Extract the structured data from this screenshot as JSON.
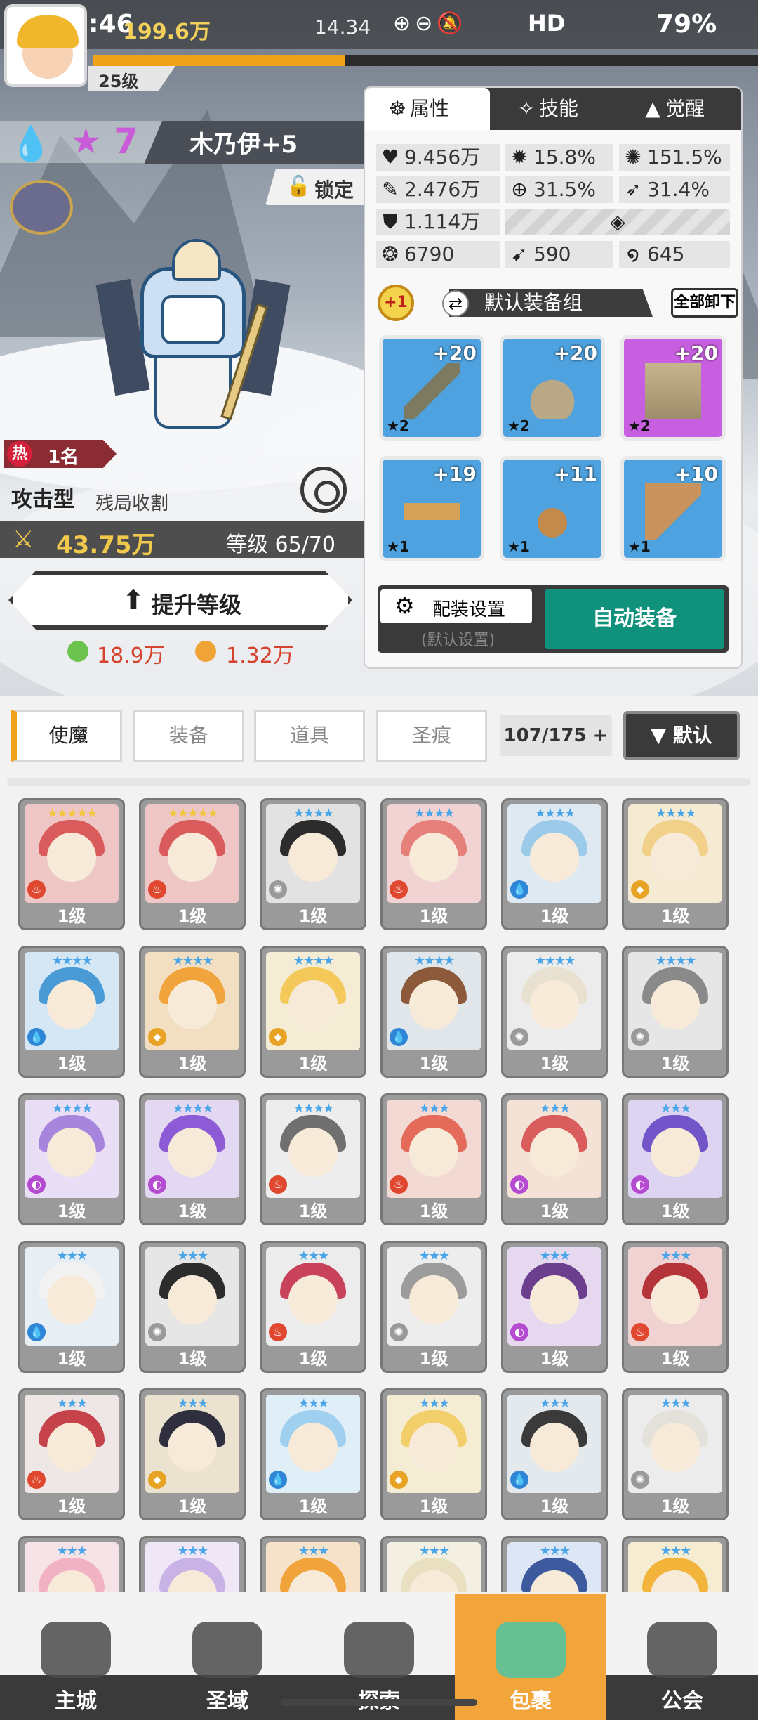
{
  "status_bar": {
    "time": "19:46",
    "resource1": "199.6万",
    "resource2": "14.34",
    "network": "HD",
    "battery": "79%"
  },
  "player": {
    "level": "25级",
    "xp_progress": 0.38
  },
  "hero": {
    "element_icon": "water-drop-icon",
    "star_icon": "★",
    "stars": "7",
    "name": "木乃伊+5",
    "lock_label": "锁定",
    "hot_icon": "热",
    "rank": "1名",
    "type": "攻击型",
    "skill_tag": "残局收割",
    "power": "43.75万",
    "level_text": "等级 65/70",
    "upgrade_label": "提升等级",
    "cost_green": "18.9万",
    "cost_gold": "1.32万"
  },
  "panel": {
    "tabs": [
      {
        "label": "属性",
        "icon": "attributes-icon"
      },
      {
        "label": "技能",
        "icon": "skill-icon"
      },
      {
        "label": "觉醒",
        "icon": "awaken-icon"
      }
    ],
    "stats": {
      "hp": "9.456万",
      "crit": "15.8%",
      "crit_dmg": "151.5%",
      "atk": "2.476万",
      "hit": "31.5%",
      "dodge": "31.4%",
      "def": "1.114万",
      "speed": "6790",
      "stat_b": "590",
      "stat_c": "645"
    },
    "equip_group_badge": "+1",
    "equip_group": "默认装备组",
    "unequip_all": "全部卸下",
    "equipment": [
      {
        "plus": "+20",
        "stars": "★2",
        "rarity": "blue",
        "item": "sword-icon"
      },
      {
        "plus": "+20",
        "stars": "★2",
        "rarity": "blue",
        "item": "helmet-icon"
      },
      {
        "plus": "+20",
        "stars": "★2",
        "rarity": "purple",
        "item": "armor-icon"
      },
      {
        "plus": "+19",
        "stars": "★1",
        "rarity": "blue",
        "item": "belt-icon"
      },
      {
        "plus": "+11",
        "stars": "★1",
        "rarity": "blue",
        "item": "necklace-icon"
      },
      {
        "plus": "+10",
        "stars": "★1",
        "rarity": "blue",
        "item": "boots-icon"
      }
    ],
    "config_label": "配装设置",
    "config_sub": "(默认设置)",
    "auto_equip": "自动装备"
  },
  "filters": {
    "tabs": [
      "使魔",
      "装备",
      "道具",
      "圣痕"
    ],
    "count": "107/175 +",
    "sort": "▼ 默认"
  },
  "grid": {
    "level_label": "1级",
    "cards": [
      {
        "stars": "★★★★★",
        "star_color": "#f2c73c",
        "hair": "#d95b5b",
        "bg": "#efc6c6",
        "el": "fire"
      },
      {
        "stars": "★★★★★",
        "star_color": "#f2c73c",
        "hair": "#d95b5b",
        "bg": "#efc6c6",
        "el": "fire"
      },
      {
        "stars": "★★★★",
        "star_color": "#4aa6e8",
        "hair": "#2c2c2c",
        "bg": "#e2e2e2",
        "el": "light"
      },
      {
        "stars": "★★★★",
        "star_color": "#4aa6e8",
        "hair": "#e6807a",
        "bg": "#f2d3d3",
        "el": "fire"
      },
      {
        "stars": "★★★★",
        "star_color": "#4aa6e8",
        "hair": "#9ccbea",
        "bg": "#dfe9f2",
        "el": "water"
      },
      {
        "stars": "★★★★",
        "star_color": "#4aa6e8",
        "hair": "#f1d08a",
        "bg": "#f5ead2",
        "el": "earth"
      },
      {
        "stars": "★★★★",
        "star_color": "#4aa6e8",
        "hair": "#4a9ad6",
        "bg": "#d5e6f4",
        "el": "water"
      },
      {
        "stars": "★★★★",
        "star_color": "#4aa6e8",
        "hair": "#f0a43b",
        "bg": "#f2dfc2",
        "el": "earth"
      },
      {
        "stars": "★★★★",
        "star_color": "#4aa6e8",
        "hair": "#f4c95a",
        "bg": "#f5ecd6",
        "el": "earth"
      },
      {
        "stars": "★★★★",
        "star_color": "#4aa6e8",
        "hair": "#8c5a3a",
        "bg": "#e0e6ea",
        "el": "water"
      },
      {
        "stars": "★★★★",
        "star_color": "#4aa6e8",
        "hair": "#e8e0d0",
        "bg": "#ececec",
        "el": "light"
      },
      {
        "stars": "★★★★",
        "star_color": "#4aa6e8",
        "hair": "#8a8a8a",
        "bg": "#e6e6e6",
        "el": "light"
      },
      {
        "stars": "★★★★",
        "star_color": "#4aa6e8",
        "hair": "#a785dc",
        "bg": "#e8def5",
        "el": "dark"
      },
      {
        "stars": "★★★★",
        "star_color": "#4aa6e8",
        "hair": "#8e5bd6",
        "bg": "#e3d8f2",
        "el": "dark"
      },
      {
        "stars": "★★★★",
        "star_color": "#4aa6e8",
        "hair": "#707070",
        "bg": "#ededed",
        "el": "fire"
      },
      {
        "stars": "★★★",
        "star_color": "#4aa6e8",
        "hair": "#e46b5a",
        "bg": "#f3d9d4",
        "el": "fire"
      },
      {
        "stars": "★★★",
        "star_color": "#4aa6e8",
        "hair": "#d95d5d",
        "bg": "#f5e2d6",
        "el": "dark"
      },
      {
        "stars": "★★★",
        "star_color": "#4aa6e8",
        "hair": "#7155c9",
        "bg": "#dcd4f0",
        "el": "dark"
      },
      {
        "stars": "★★★",
        "star_color": "#4aa6e8",
        "hair": "#f2f2f2",
        "bg": "#e7eef4",
        "el": "water"
      },
      {
        "stars": "★★★",
        "star_color": "#4aa6e8",
        "hair": "#2c2c2c",
        "bg": "#e6e6e6",
        "el": "light"
      },
      {
        "stars": "★★★",
        "star_color": "#4aa6e8",
        "hair": "#c9425b",
        "bg": "#ececec",
        "el": "fire"
      },
      {
        "stars": "★★★",
        "star_color": "#4aa6e8",
        "hair": "#9c9c9c",
        "bg": "#ededed",
        "el": "light"
      },
      {
        "stars": "★★★",
        "star_color": "#4aa6e8",
        "hair": "#6b3f8e",
        "bg": "#e6d8ef",
        "el": "dark"
      },
      {
        "stars": "★★★",
        "star_color": "#4aa6e8",
        "hair": "#b5343a",
        "bg": "#f0d2d2",
        "el": "fire"
      },
      {
        "stars": "★★★",
        "star_color": "#4aa6e8",
        "hair": "#c6434c",
        "bg": "#efe6e6",
        "el": "fire"
      },
      {
        "stars": "★★★",
        "star_color": "#4aa6e8",
        "hair": "#2f2f3f",
        "bg": "#ebe2cf",
        "el": "earth"
      },
      {
        "stars": "★★★",
        "star_color": "#4aa6e8",
        "hair": "#9fd0ef",
        "bg": "#e0eef7",
        "el": "water"
      },
      {
        "stars": "★★★",
        "star_color": "#4aa6e8",
        "hair": "#f2cf6b",
        "bg": "#f5ecd4",
        "el": "earth"
      },
      {
        "stars": "★★★",
        "star_color": "#4aa6e8",
        "hair": "#3a3a3a",
        "bg": "#e4e9ee",
        "el": "water"
      },
      {
        "stars": "★★★",
        "star_color": "#4aa6e8",
        "hair": "#e3e1d9",
        "bg": "#ececec",
        "el": "light"
      },
      {
        "stars": "★★★",
        "star_color": "#4aa6e8",
        "hair": "#f1b2c4",
        "bg": "#f6e3e8",
        "el": "fire"
      },
      {
        "stars": "★★★",
        "star_color": "#4aa6e8",
        "hair": "#c9b2e6",
        "bg": "#efe6f6",
        "el": "dark"
      },
      {
        "stars": "★★★",
        "star_color": "#4aa6e8",
        "hair": "#f0a43b",
        "bg": "#f6e2c8",
        "el": "earth"
      },
      {
        "stars": "★★★",
        "star_color": "#4aa6e8",
        "hair": "#e8e0c0",
        "bg": "#f3efe2",
        "el": "earth"
      },
      {
        "stars": "★★★",
        "star_color": "#4aa6e8",
        "hair": "#3e5a9e",
        "bg": "#dde6f4",
        "el": "water"
      },
      {
        "stars": "★★★",
        "star_color": "#4aa6e8",
        "hair": "#f2b43a",
        "bg": "#f6ecd2",
        "el": "earth"
      }
    ]
  },
  "nav": [
    {
      "label": "主城",
      "icon": "castle-icon"
    },
    {
      "label": "圣域",
      "icon": "vortex-icon"
    },
    {
      "label": "探索",
      "icon": "sword-stone-icon"
    },
    {
      "label": "包裹",
      "icon": "bag-icon"
    },
    {
      "label": "公会",
      "icon": "guild-icon"
    }
  ],
  "colors": {
    "accent": "#f0a21a",
    "auto_equip": "#10917b",
    "panel_dark": "#3a3a3a",
    "cost_red": "#d5442e"
  }
}
